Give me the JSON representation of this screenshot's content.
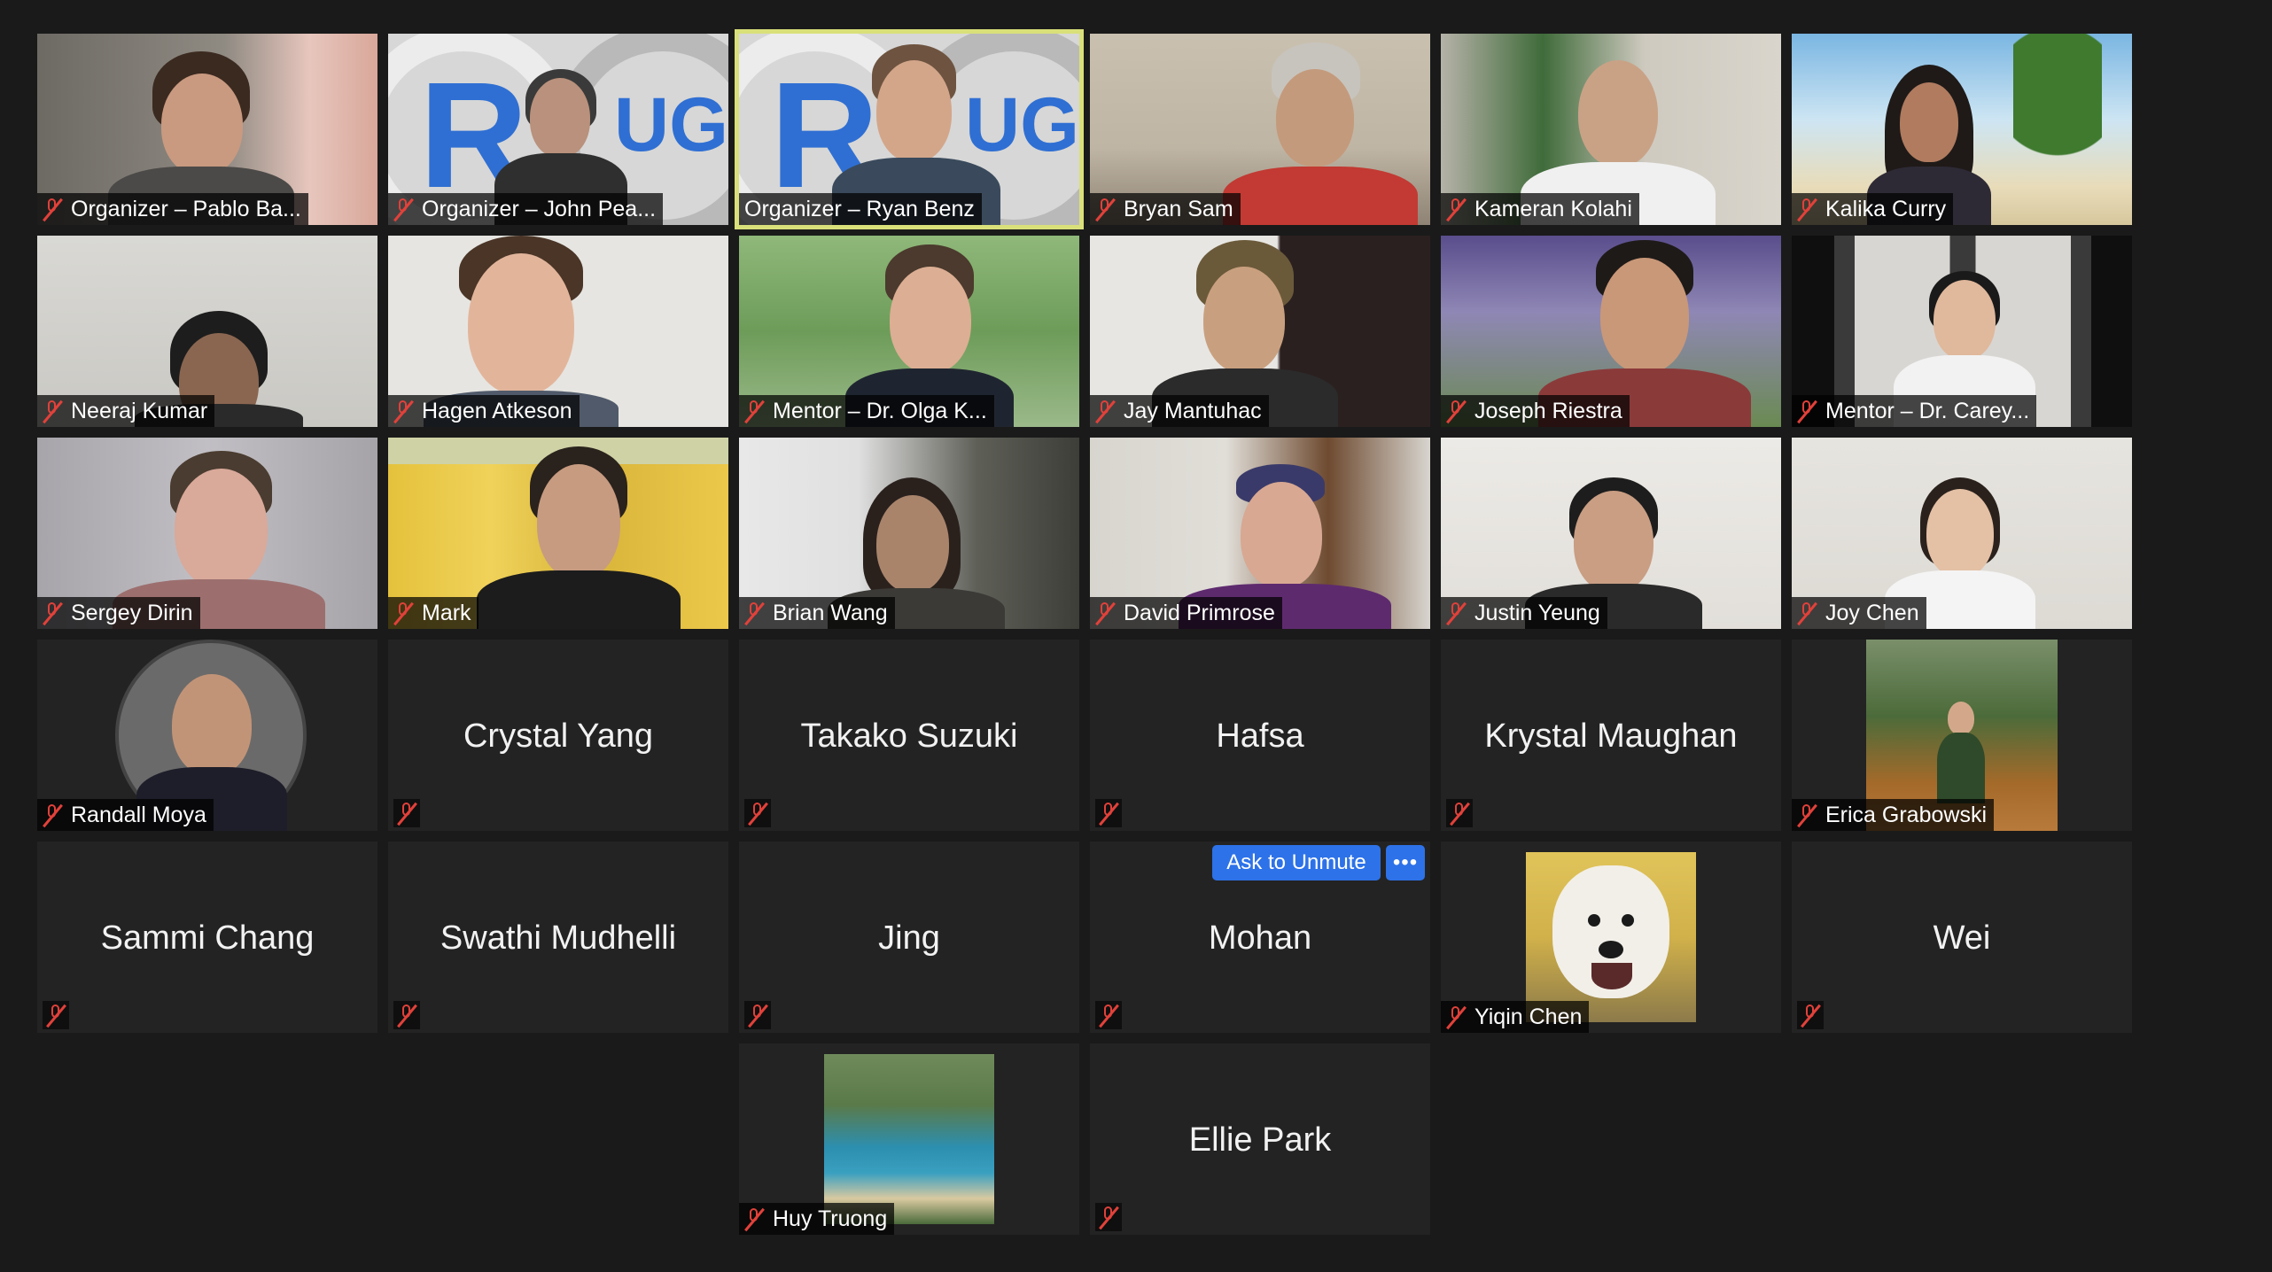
{
  "meeting": {
    "participants": [
      {
        "name": "Organizer – Pablo Ba...",
        "type": "video",
        "muted": true
      },
      {
        "name": "Organizer – John Pea...",
        "type": "video",
        "muted": true
      },
      {
        "name": "Organizer – Ryan Benz",
        "type": "video",
        "muted": false,
        "active_speaker": true
      },
      {
        "name": "Bryan Sam",
        "type": "video",
        "muted": true
      },
      {
        "name": "Kameran Kolahi",
        "type": "video",
        "muted": true
      },
      {
        "name": "Kalika Curry",
        "type": "video",
        "muted": true
      },
      {
        "name": "Neeraj Kumar",
        "type": "video",
        "muted": true
      },
      {
        "name": "Hagen Atkeson",
        "type": "video",
        "muted": true
      },
      {
        "name": "Mentor – Dr. Olga K...",
        "type": "video",
        "muted": true
      },
      {
        "name": "Jay Mantuhac",
        "type": "video",
        "muted": true
      },
      {
        "name": "Joseph Riestra",
        "type": "video",
        "muted": true
      },
      {
        "name": "Mentor – Dr. Carey...",
        "type": "video",
        "muted": true
      },
      {
        "name": "Sergey Dirin",
        "type": "video",
        "muted": true
      },
      {
        "name": "Mark",
        "type": "video",
        "muted": true
      },
      {
        "name": "Brian Wang",
        "type": "video",
        "muted": true
      },
      {
        "name": "David Primrose",
        "type": "video",
        "muted": true
      },
      {
        "name": "Justin Yeung",
        "type": "video",
        "muted": true
      },
      {
        "name": "Joy Chen",
        "type": "video",
        "muted": true
      },
      {
        "name": "Randall Moya",
        "type": "avatar",
        "muted": true
      },
      {
        "name": "Crystal Yang",
        "type": "name",
        "muted": true
      },
      {
        "name": "Takako Suzuki",
        "type": "name",
        "muted": true
      },
      {
        "name": "Hafsa",
        "type": "name",
        "muted": true
      },
      {
        "name": "Krystal Maughan",
        "type": "name",
        "muted": true
      },
      {
        "name": "Erica Grabowski",
        "type": "avatar",
        "muted": true
      },
      {
        "name": "Sammi Chang",
        "type": "name",
        "muted": true
      },
      {
        "name": "Swathi Mudhelli",
        "type": "name",
        "muted": true
      },
      {
        "name": "Jing",
        "type": "name",
        "muted": true
      },
      {
        "name": "Mohan",
        "type": "name",
        "muted": true
      },
      {
        "name": "Yiqin Chen",
        "type": "avatar",
        "muted": true
      },
      {
        "name": "Wei",
        "type": "name",
        "muted": true
      },
      {
        "name": "Huy Truong",
        "type": "avatar",
        "muted": true
      },
      {
        "name": "Ellie Park",
        "type": "name",
        "muted": true
      }
    ],
    "hover_controls": {
      "ask_to_unmute_label": "Ask to Unmute",
      "more_label": "•••"
    },
    "colors": {
      "background": "#1a1a1a",
      "tile": "#232323",
      "active_speaker_border": "#d9e07a",
      "muted_icon": "#e1413a",
      "button": "#2d72e8"
    },
    "icons": {
      "muted": "mic-muted-icon",
      "more": "more-options-icon"
    }
  }
}
